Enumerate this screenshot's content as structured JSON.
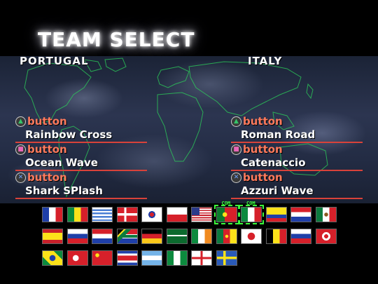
{
  "screen_title": "TEAM SELECT",
  "left_team": {
    "name": "PORTUGAL",
    "moves": [
      {
        "button": "triangle",
        "button_label": "button",
        "move": "Rainbow Cross"
      },
      {
        "button": "square",
        "button_label": "button",
        "move": "Ocean Wave"
      },
      {
        "button": "cross",
        "button_label": "button",
        "move": "Shark SPlash"
      }
    ]
  },
  "right_team": {
    "name": "ITALY",
    "moves": [
      {
        "button": "triangle",
        "button_label": "button",
        "move": "Roman Road"
      },
      {
        "button": "square",
        "button_label": "button",
        "move": "Catenaccio"
      },
      {
        "button": "cross",
        "button_label": "button",
        "move": "Azzuri Wave"
      }
    ]
  },
  "com_label": "COM",
  "flags": [
    [
      "france",
      "senegal",
      "uruguay",
      "denmark",
      "south-korea",
      "poland",
      "usa",
      "portugal",
      "italy",
      "ecuador",
      "croatia",
      "mexico"
    ],
    [
      "spain",
      "slovenia",
      "paraguay",
      "south-africa",
      "germany",
      "saudi-arabia",
      "ireland",
      "cameroon",
      "japan",
      "belgium",
      "russia",
      "tunisia"
    ],
    [
      "brazil",
      "turkey",
      "china",
      "costa-rica",
      "argentina",
      "nigeria",
      "england",
      "sweden"
    ]
  ],
  "selected_flags": [
    "portugal",
    "italy"
  ],
  "colors": {
    "accent_red": "#d8423a",
    "button_word": "#ff7a5c",
    "com_green": "#3cff3c"
  }
}
